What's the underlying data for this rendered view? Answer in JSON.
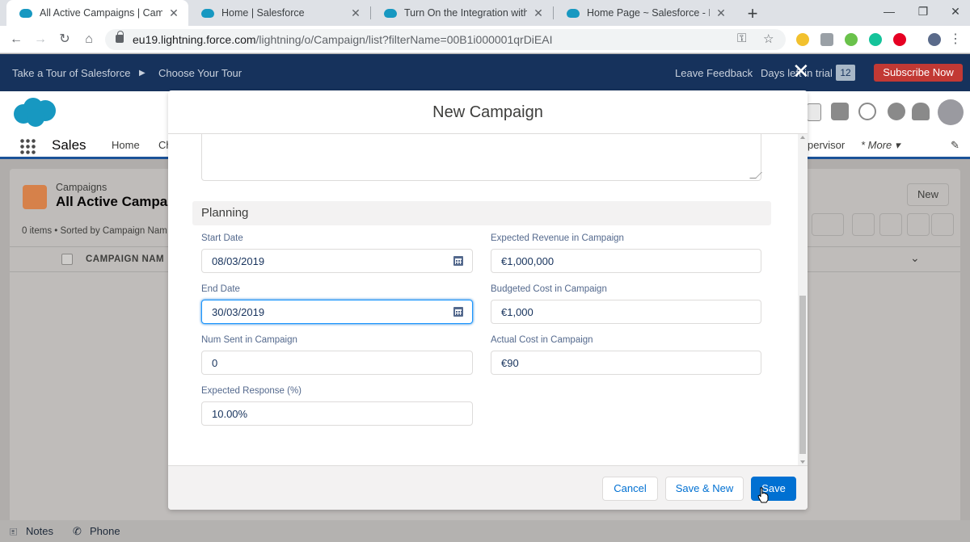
{
  "browser": {
    "tabs": [
      {
        "title": "All Active Campaigns | Campaign",
        "active": true
      },
      {
        "title": "Home | Salesforce",
        "active": false
      },
      {
        "title": "Turn On the Integration with Out",
        "active": false
      },
      {
        "title": "Home Page ~ Salesforce - Essenti",
        "active": false
      }
    ],
    "url_host": "eu19.lightning.force.com",
    "url_path": "/lightning/o/Campaign/list?filterName=00B1i000001qrDiEAI"
  },
  "trial_bar": {
    "tour": "Take a Tour of Salesforce",
    "choose_tour": "Choose Your Tour",
    "leave_feedback": "Leave Feedback",
    "days_left": "Days left in trial",
    "days_count": "12",
    "subscribe": "Subscribe Now"
  },
  "app": {
    "name": "Sales",
    "nav_home": "Home",
    "nav_partial": "Ch",
    "nav_supervisor": "pervisor",
    "nav_more": "More",
    "list_object": "Campaigns",
    "list_title": "All Active Campa",
    "list_status": "0 items • Sorted by Campaign Nam",
    "column_header": "CAMPAIGN NAM",
    "new_button": "New"
  },
  "modal": {
    "title": "New Campaign",
    "section_planning": "Planning",
    "fields": {
      "start_date": {
        "label": "Start Date",
        "value": "08/03/2019"
      },
      "end_date": {
        "label": "End Date",
        "value": "30/03/2019"
      },
      "num_sent": {
        "label": "Num Sent in Campaign",
        "value": "0"
      },
      "expected_response": {
        "label": "Expected Response (%)",
        "value": "10.00%"
      },
      "expected_revenue": {
        "label": "Expected Revenue in Campaign",
        "value": "€1,000,000"
      },
      "budgeted_cost": {
        "label": "Budgeted Cost in Campaign",
        "value": "€1,000"
      },
      "actual_cost": {
        "label": "Actual Cost in Campaign",
        "value": "€90"
      }
    },
    "buttons": {
      "cancel": "Cancel",
      "save_new": "Save & New",
      "save": "Save"
    }
  },
  "utility_bar": {
    "notes": "Notes",
    "phone": "Phone"
  },
  "colors": {
    "brand": "#0070d2",
    "header_navy": "#16325c",
    "subscribe_red": "#c23934",
    "focus": "#1b96ff"
  },
  "icons": [
    "salesforce-cloud-icon",
    "back-icon",
    "forward-icon",
    "reload-icon",
    "home-icon",
    "lock-icon",
    "key-icon",
    "star-icon",
    "calendar-icon",
    "app-launcher-icon",
    "add-icon",
    "help-icon",
    "gear-icon",
    "bell-icon",
    "avatar",
    "notes-icon",
    "phone-icon"
  ]
}
